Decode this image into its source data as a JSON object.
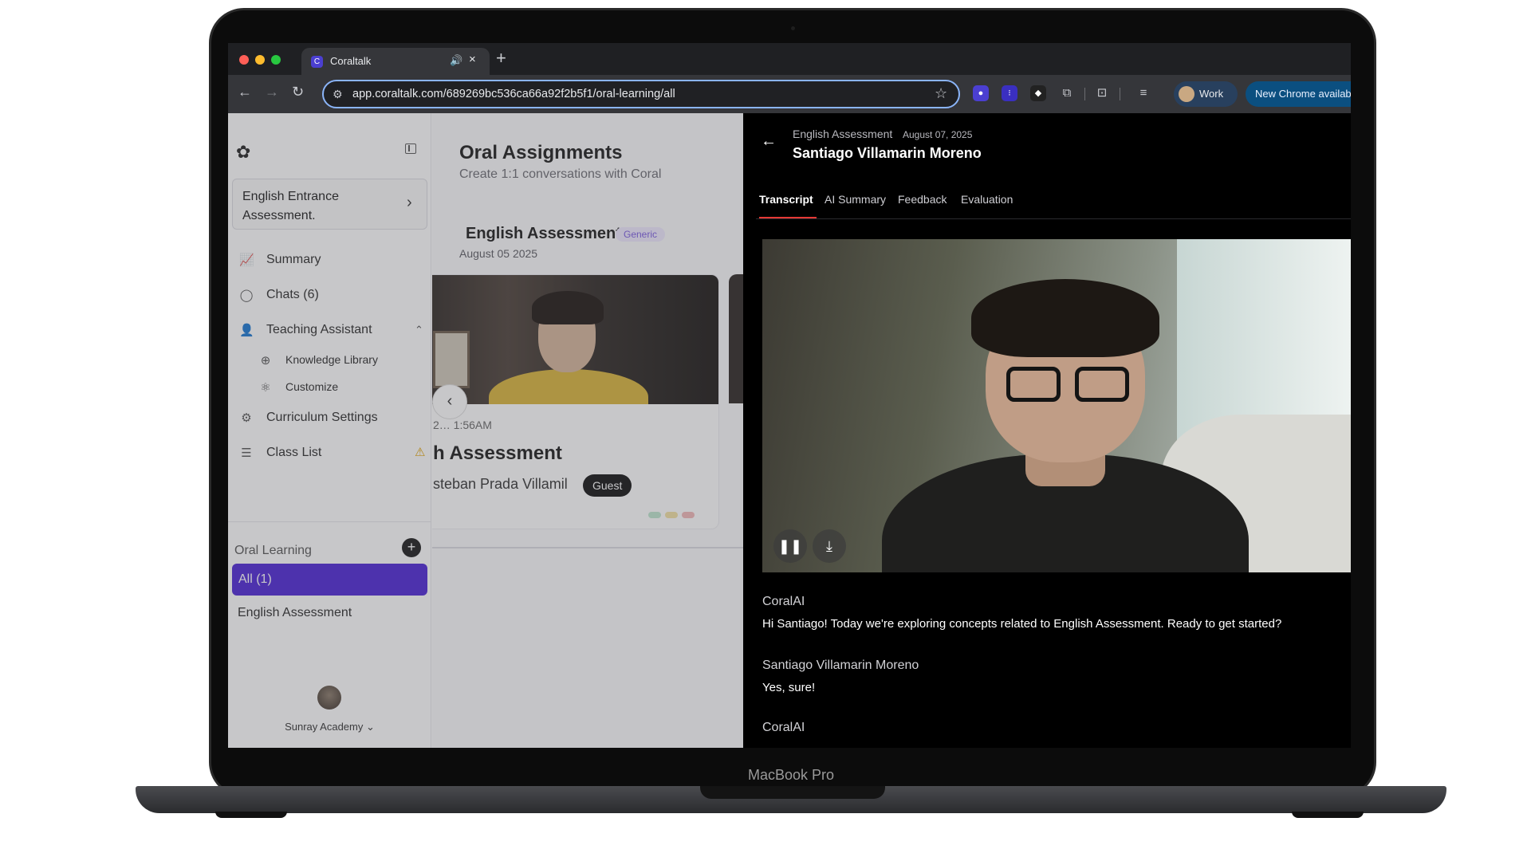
{
  "browser": {
    "tab_title": "Coraltalk",
    "tab_favicon": "C",
    "url": "app.coraltalk.com/689269bc536ca66a92f2b5f1/oral-learning/all",
    "profile_label": "Work",
    "update_label": "New Chrome availab",
    "icons": [
      "back-icon",
      "forward-icon",
      "reload-icon",
      "site-settings-icon",
      "star-icon",
      "extensions-icon",
      "screenshot-icon",
      "media-icon"
    ]
  },
  "device": {
    "label": "MacBook Pro"
  },
  "sidebar": {
    "course_selector": "English Entrance Assessment.",
    "nav": {
      "summary": "Summary",
      "chats": "Chats  (6)",
      "teaching_assistant": "Teaching Assistant",
      "knowledge_library": "Knowledge Library",
      "customize": "Customize",
      "curriculum_settings": "Curriculum Settings",
      "class_list": "Class List"
    },
    "oral_learning_label": "Oral Learning",
    "all_label": "All (1)",
    "english_assessment": "English Assessment",
    "user_org": "Sunray Academy"
  },
  "middle": {
    "title": "Oral Assignments",
    "subtitle": "Create 1:1 conversations with Coral",
    "group_title": "English Assessment",
    "group_badge": "Generic",
    "group_date": "August 05 2025",
    "card": {
      "time": "2… 1:56AM",
      "title": "h Assessment",
      "student": "steban Prada Villamil",
      "badge": "Guest",
      "dot_colors": [
        "#bfe6cf",
        "#f3e2a4",
        "#f2b8b8"
      ]
    }
  },
  "drawer": {
    "breadcrumb": "English Assessment",
    "date": "August 07, 2025",
    "student_name": "Santiago Villamarin Moreno",
    "tabs": [
      "Transcript",
      "AI Summary",
      "Feedback",
      "Evaluation"
    ],
    "active_tab": "Transcript",
    "transcript": [
      {
        "speaker": "CoralAI",
        "text": "Hi Santiago! Today we're exploring concepts related to English Assessment. Ready to get started?"
      },
      {
        "speaker": "Santiago Villamarin Moreno",
        "text": "Yes, sure!"
      },
      {
        "speaker": "CoralAI",
        "text": ""
      }
    ]
  },
  "colors": {
    "accent": "#4c24d6",
    "tab_indicator": "#e53935"
  }
}
